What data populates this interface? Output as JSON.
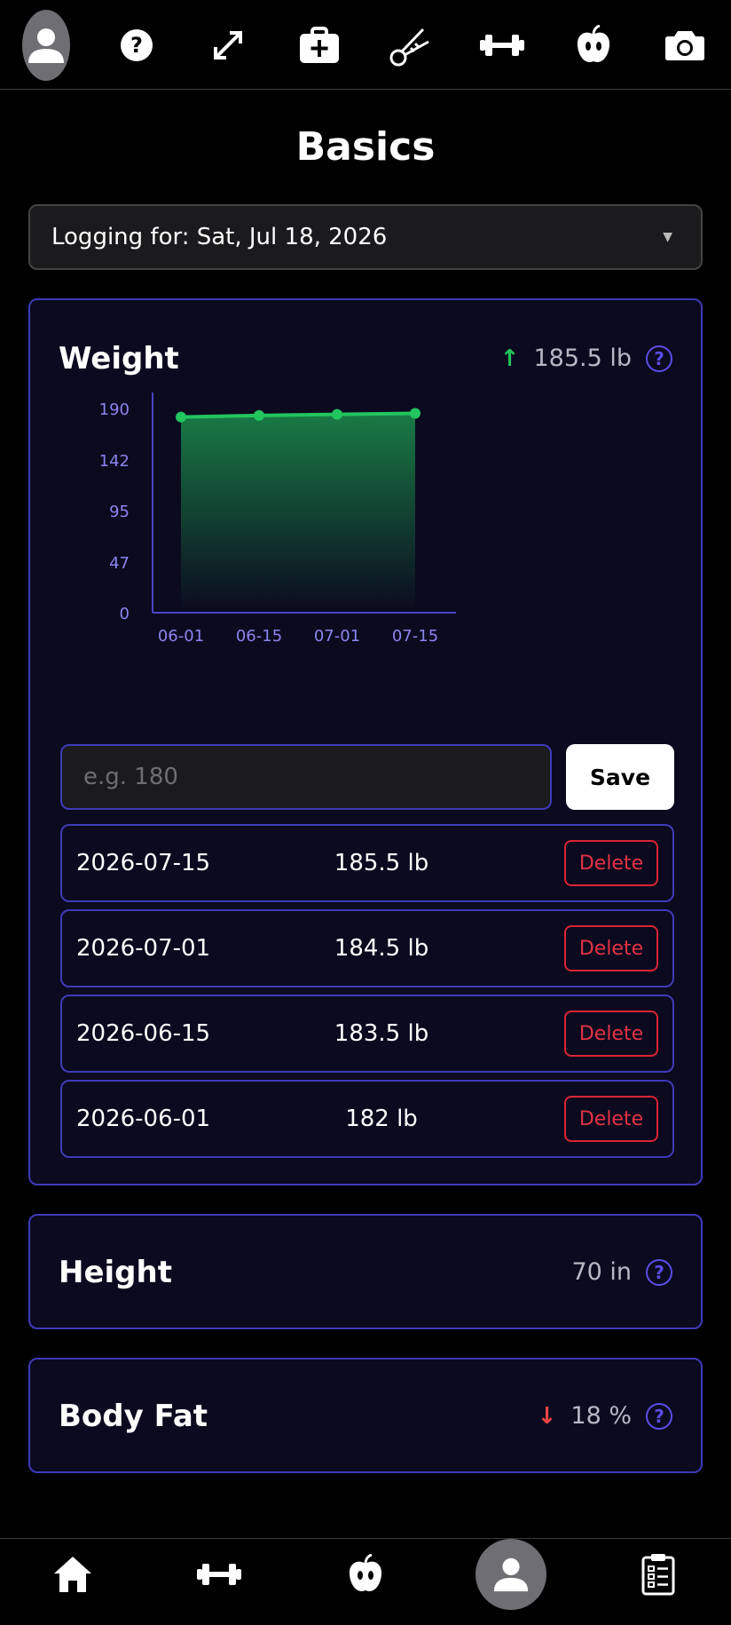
{
  "top_nav": {
    "items": [
      {
        "icon": "profile-icon",
        "active": true
      },
      {
        "icon": "help-icon"
      },
      {
        "icon": "resize-icon"
      },
      {
        "icon": "first-aid-icon"
      },
      {
        "icon": "hand-grip-icon"
      },
      {
        "icon": "dumbbell-icon"
      },
      {
        "icon": "apple-icon"
      },
      {
        "icon": "camera-icon"
      }
    ]
  },
  "page": {
    "title": "Basics"
  },
  "date_select": {
    "label": "Logging for: Sat, Jul 18, 2026"
  },
  "weight": {
    "title": "Weight",
    "current": "185.5 lb",
    "trend": "up",
    "trend_color": "#22c55e",
    "input_placeholder": "e.g. 180",
    "save_label": "Save",
    "entries": [
      {
        "date": "2026-07-15",
        "value": "185.5 lb",
        "delete_label": "Delete"
      },
      {
        "date": "2026-07-01",
        "value": "184.5 lb",
        "delete_label": "Delete"
      },
      {
        "date": "2026-06-15",
        "value": "183.5 lb",
        "delete_label": "Delete"
      },
      {
        "date": "2026-06-01",
        "value": "182 lb",
        "delete_label": "Delete"
      }
    ]
  },
  "chart_data": {
    "type": "area",
    "categories": [
      "06-01",
      "06-15",
      "07-01",
      "07-15"
    ],
    "values": [
      182,
      183.5,
      184.5,
      185.5
    ],
    "y_ticks": [
      "0",
      "47",
      "95",
      "142",
      "190"
    ],
    "ylim": [
      0,
      190
    ],
    "line_color": "#22c55e",
    "axis_color": "#4b44c7",
    "tick_color": "#8b85f0"
  },
  "height": {
    "title": "Height",
    "value": "70 in"
  },
  "body_fat": {
    "title": "Body Fat",
    "value": "18 %",
    "trend": "down",
    "trend_color": "#ef4444"
  },
  "bottom_nav": {
    "items": [
      {
        "icon": "home-icon"
      },
      {
        "icon": "dumbbell-icon"
      },
      {
        "icon": "apple-icon"
      },
      {
        "icon": "profile-icon",
        "active": true
      },
      {
        "icon": "clipboard-icon"
      }
    ]
  }
}
